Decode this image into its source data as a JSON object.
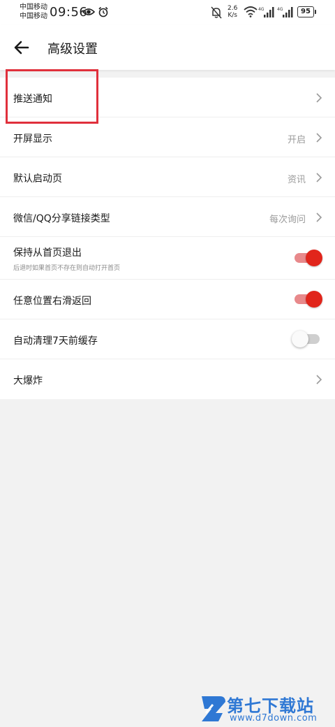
{
  "status_bar": {
    "carrier1": "中国移动",
    "carrier2": "中国移动",
    "time": "09:56",
    "net_speed_value": "2.6",
    "net_speed_unit": "K/s",
    "battery": "95"
  },
  "header": {
    "title": "高级设置"
  },
  "settings": {
    "push_notification": {
      "label": "推送通知"
    },
    "splash_display": {
      "label": "开屏显示",
      "value": "开启"
    },
    "default_start_page": {
      "label": "默认启动页",
      "value": "资讯"
    },
    "wechat_qq_link_type": {
      "label": "微信/QQ分享链接类型",
      "value": "每次询问"
    },
    "exit_from_home": {
      "label": "保持从首页退出",
      "sublabel": "后退时如果首页不存在则自动打开首页",
      "enabled": true
    },
    "swipe_back": {
      "label": "任意位置右滑返回",
      "enabled": true
    },
    "auto_clear_cache": {
      "label": "自动清理7天前缓存",
      "enabled": false
    },
    "big_explosion": {
      "label": "大爆炸"
    }
  },
  "colors": {
    "accent": "#e1251b",
    "highlight": "#e0303c",
    "background": "#f2f2f2"
  },
  "watermark": {
    "text": "第七下载站",
    "url": "www.d7down.com"
  }
}
